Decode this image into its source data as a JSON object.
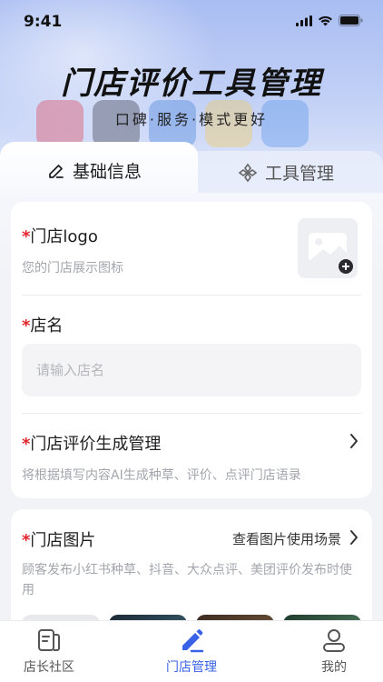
{
  "status_bar": {
    "time": "9:41"
  },
  "hero": {
    "title": "门店评价工具管理",
    "subtitle": "口碑·服务·模式更好"
  },
  "tabs": [
    {
      "label": "基础信息",
      "icon": "edit-icon",
      "active": true
    },
    {
      "label": "工具管理",
      "icon": "tools-icon",
      "active": false
    }
  ],
  "form": {
    "logo": {
      "required_mark": "*",
      "title": "门店logo",
      "desc": "您的门店展示图标"
    },
    "name": {
      "required_mark": "*",
      "title": "店名",
      "placeholder": "请输入店名",
      "value": ""
    },
    "review_gen": {
      "required_mark": "*",
      "title": "门店评价生成管理",
      "desc": "将根据填写内容AI生成种草、评价、点评门店语录"
    },
    "photos": {
      "required_mark": "*",
      "title": "门店图片",
      "link": "查看图片使用场景",
      "desc": "顾客发布小红书种草、抖音、大众点评、美团评价发布时使用"
    }
  },
  "bottom_nav": [
    {
      "label": "店长社区",
      "icon": "community-icon",
      "active": false
    },
    {
      "label": "门店管理",
      "icon": "pen-icon",
      "active": true
    },
    {
      "label": "我的",
      "icon": "user-icon",
      "active": false
    }
  ],
  "colors": {
    "accent": "#3a62e8",
    "required": "#e0262c",
    "hero_gradient_top": "#a9bdf2",
    "background": "#f2f3f7"
  }
}
